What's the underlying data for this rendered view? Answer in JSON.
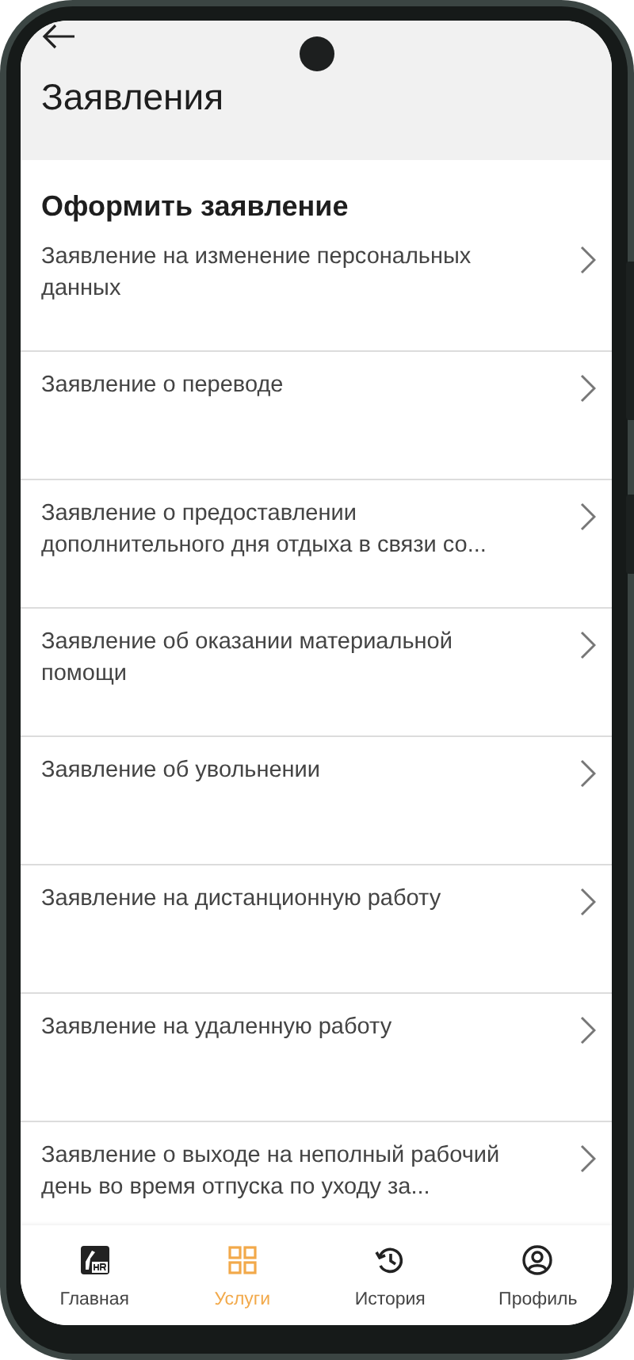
{
  "header": {
    "title": "Заявления"
  },
  "section_title": "Оформить заявление",
  "items": [
    {
      "label": "Заявление на изменение персональных данных"
    },
    {
      "label": "Заявление о переводе"
    },
    {
      "label": "Заявление о предоставлении дополнительного дня отдыха в связи со..."
    },
    {
      "label": "Заявление об оказании материальной помощи"
    },
    {
      "label": "Заявление об увольнении"
    },
    {
      "label": "Заявление на дистанционную работу"
    },
    {
      "label": "Заявление на удаленную работу"
    },
    {
      "label": "Заявление о выходе на неполный рабочий день во время отпуска по уходу за..."
    }
  ],
  "nav": [
    {
      "kind": "home",
      "label": "Главная",
      "selected": false
    },
    {
      "kind": "services",
      "label": "Услуги",
      "selected": true
    },
    {
      "kind": "history",
      "label": "История",
      "selected": false
    },
    {
      "kind": "profile",
      "label": "Профиль",
      "selected": false
    }
  ]
}
